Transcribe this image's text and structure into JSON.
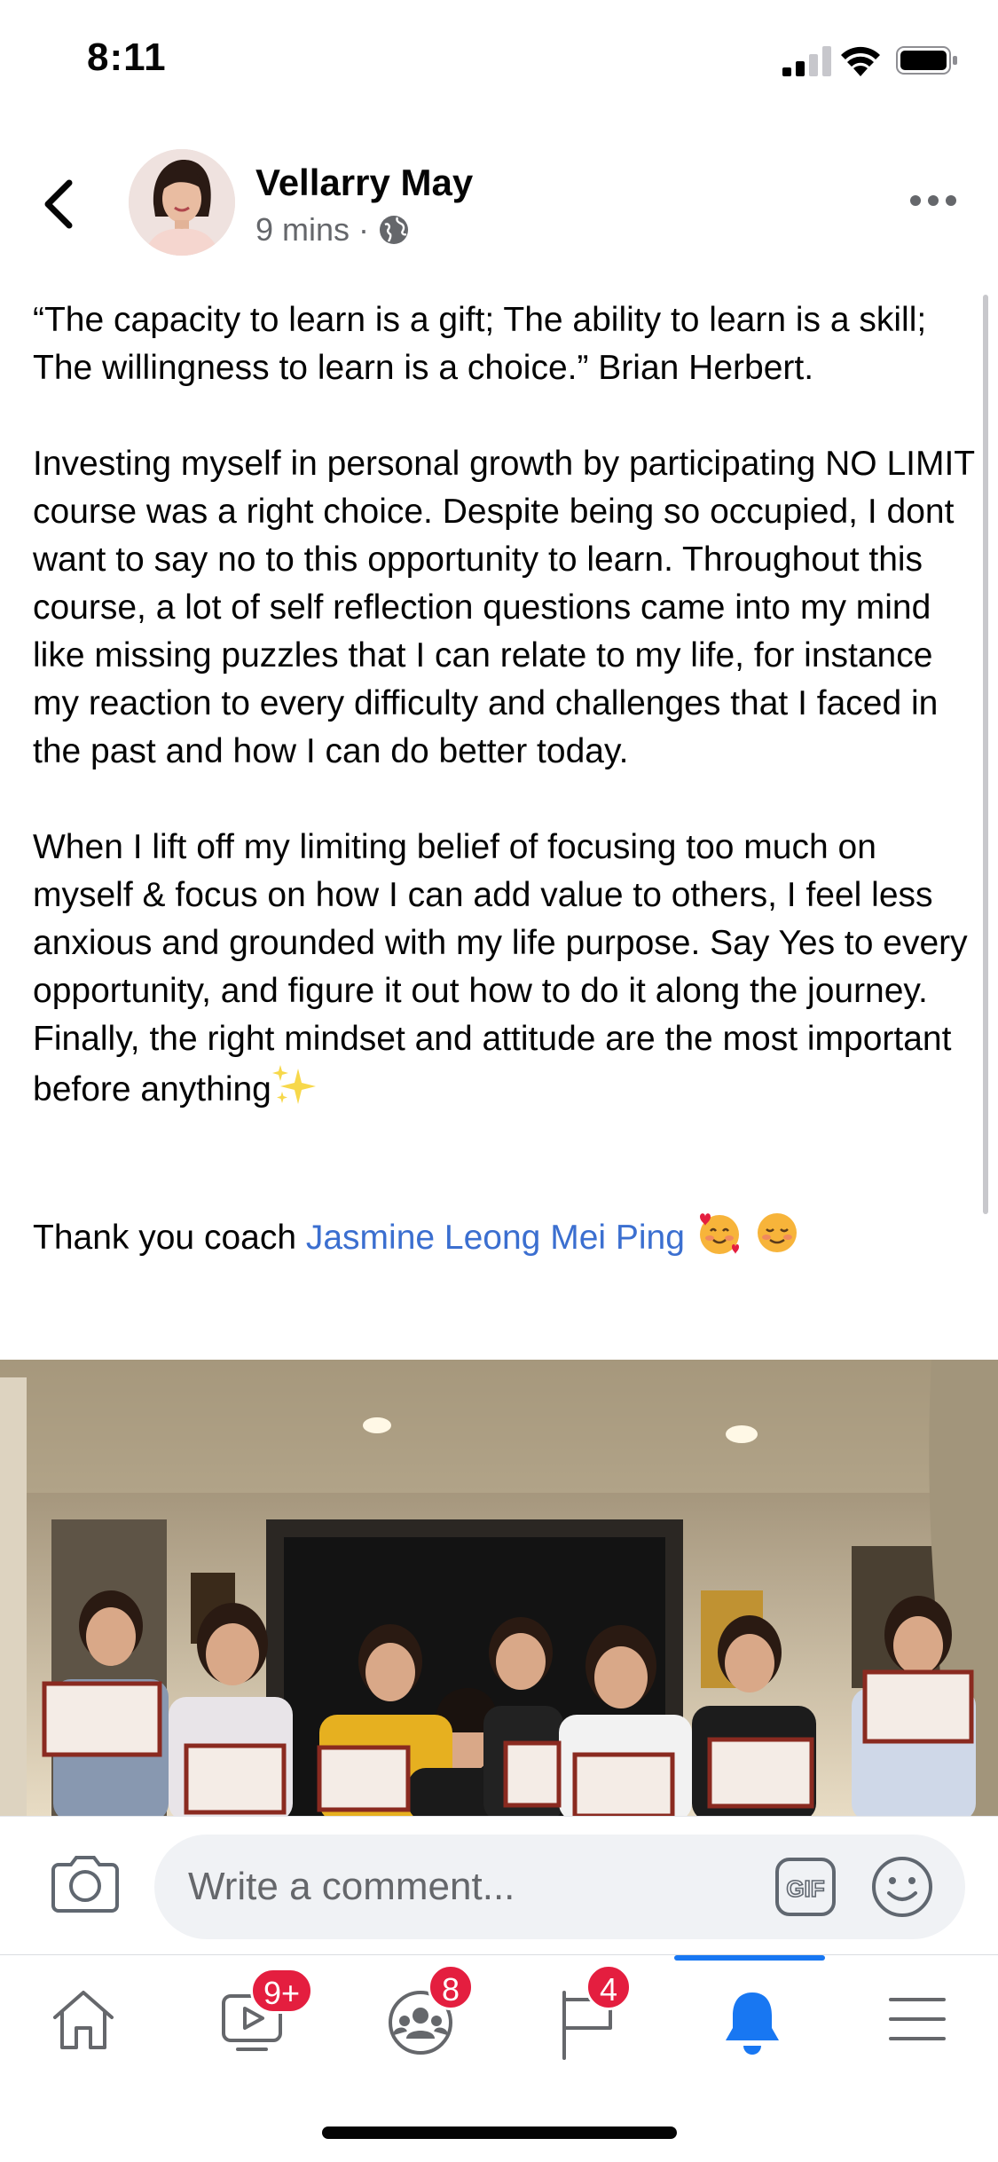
{
  "status_bar": {
    "time": "8:11"
  },
  "post": {
    "author": "Vellarry May",
    "time_ago": "9 mins",
    "meta_separator": "·",
    "paragraphs": {
      "p1": "“The capacity to learn is a gift; The ability to learn is a skill; The willingness to learn is a choice.”  Brian Herbert.",
      "p2": "Investing myself in personal growth by participating NO LIMIT course was a right choice. Despite being so occupied, I dont want to say no to this opportunity to learn. Throughout this course, a lot of self reflection questions came into my mind like missing puzzles that I can relate to my life, for instance my reaction to every difficulty and challenges that I faced in the past and how I can do better today.",
      "p3": "When I lift off my limiting belief of focusing too much on myself & focus on how I can add value to others, I feel less anxious and grounded with my life purpose. Say Yes to every opportunity, and figure it out how to do it along the journey. Finally, the right mindset and attitude are the most important before anything",
      "p4_prefix": "Thank you coach ",
      "mention": "Jasmine Leong Mei Ping"
    }
  },
  "comment_bar": {
    "placeholder": "Write a comment...",
    "gif_label": "GIF"
  },
  "tab_bar": {
    "tabs": [
      {
        "name": "home",
        "badge": ""
      },
      {
        "name": "watch",
        "badge": "9+"
      },
      {
        "name": "groups",
        "badge": "8"
      },
      {
        "name": "pages",
        "badge": "4"
      },
      {
        "name": "notifications",
        "badge": "",
        "active": true
      },
      {
        "name": "menu",
        "badge": ""
      }
    ]
  },
  "colors": {
    "accent": "#1877f2",
    "mention": "#3b6fd0",
    "badge": "#e41e3f",
    "meta": "#65676b"
  }
}
